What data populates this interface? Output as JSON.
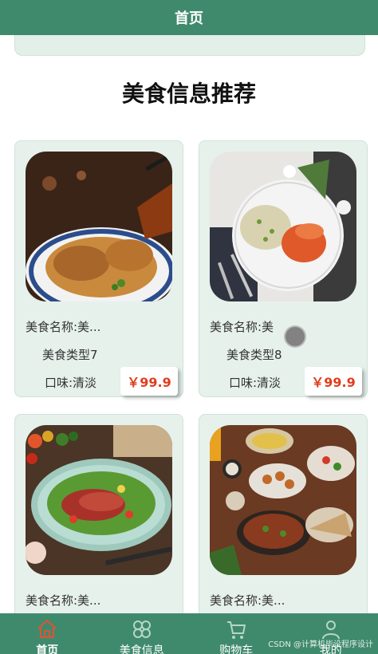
{
  "header": {
    "title": "首页"
  },
  "section": {
    "title": "美食信息推荐"
  },
  "cards": [
    {
      "name": "美食名称:美...",
      "type": "美食类型7",
      "taste": "口味:清淡",
      "price": "￥99.9"
    },
    {
      "name": "美食名称:美",
      "type": "美食类型8",
      "taste": "口味:清淡",
      "price": "￥99.9"
    },
    {
      "name": "美食名称:美...",
      "type": "",
      "taste": "",
      "price": ""
    },
    {
      "name": "美食名称:美...",
      "type": "",
      "taste": "",
      "price": ""
    }
  ],
  "tabbar": {
    "items": [
      {
        "label": "首页",
        "icon": "home-icon"
      },
      {
        "label": "美食信息",
        "icon": "clover-icon"
      },
      {
        "label": "购物车",
        "icon": "cart-icon"
      },
      {
        "label": "我的",
        "icon": "user-icon"
      }
    ]
  },
  "watermark": "CSDN @计算机毕设程序设计",
  "colors": {
    "brand": "#3f8a6c",
    "card_bg": "#e6f1ec",
    "price": "#e03d1e"
  }
}
